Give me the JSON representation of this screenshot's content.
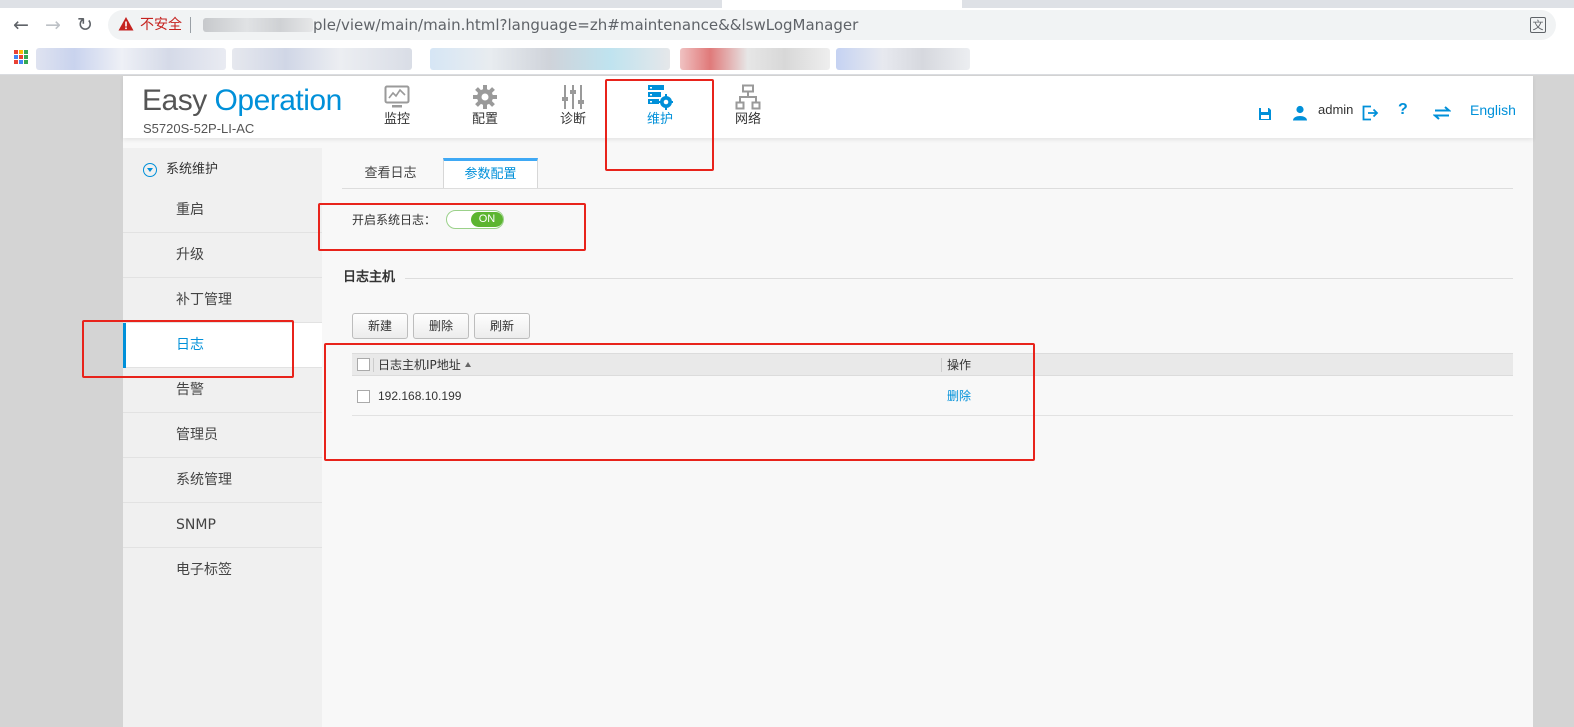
{
  "browser": {
    "insecure_label": "不安全",
    "url": "ple/view/main/main.html?language=zh#maintenance&&lswLogManager"
  },
  "header": {
    "logo_easy": "Easy",
    "logo_operation": "Operation",
    "model": "S5720S-52P-LI-AC",
    "nav": [
      {
        "label": "监控",
        "icon": "monitor-icon"
      },
      {
        "label": "配置",
        "icon": "gear-icon"
      },
      {
        "label": "诊断",
        "icon": "sliders-icon"
      },
      {
        "label": "维护",
        "icon": "server-gear-icon",
        "active": true
      },
      {
        "label": "网络",
        "icon": "network-icon"
      }
    ],
    "user": "admin",
    "help": "?",
    "language": "English"
  },
  "sidebar": {
    "group": "系统维护",
    "items": [
      {
        "label": "重启"
      },
      {
        "label": "升级"
      },
      {
        "label": "补丁管理"
      },
      {
        "label": "日志",
        "active": true
      },
      {
        "label": "告警"
      },
      {
        "label": "管理员"
      },
      {
        "label": "系统管理"
      },
      {
        "label": "SNMP"
      },
      {
        "label": "电子标签"
      }
    ]
  },
  "content": {
    "tabs": [
      {
        "label": "查看日志"
      },
      {
        "label": "参数配置",
        "active": true
      }
    ],
    "syslog_label": "开启系统日志：",
    "syslog_state": "ON",
    "section_title": "日志主机",
    "buttons": {
      "new": "新建",
      "delete": "删除",
      "refresh": "刷新"
    },
    "table": {
      "columns": [
        "日志主机IP地址",
        "操作"
      ],
      "rows": [
        {
          "ip": "192.168.10.199",
          "action": "删除"
        }
      ]
    }
  },
  "colors": {
    "accent": "#0090d9",
    "toggle_on": "#5cb531",
    "annotation": "#e8231b"
  }
}
